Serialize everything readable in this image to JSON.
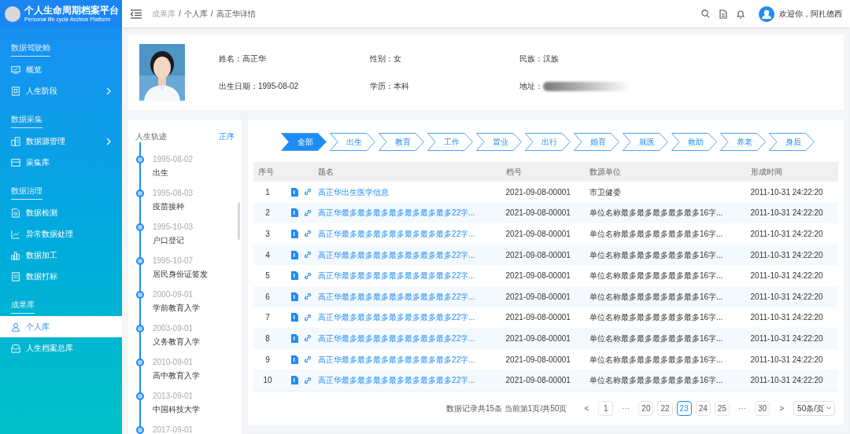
{
  "app": {
    "title": "个人生命周期档案平台",
    "subtitle": "Personal life cycle Archive Platform"
  },
  "sidebar": {
    "sections": [
      {
        "title": "数据驾驶舱",
        "items": [
          {
            "label": "概览",
            "selected": false,
            "expandable": false
          },
          {
            "label": "人生阶段",
            "selected": false,
            "expandable": true
          }
        ]
      },
      {
        "title": "数据采集",
        "items": [
          {
            "label": "数据源管理",
            "selected": false,
            "expandable": true
          },
          {
            "label": "采集库",
            "selected": false,
            "expandable": false
          }
        ]
      },
      {
        "title": "数据治理",
        "items": [
          {
            "label": "数据检测",
            "selected": false,
            "expandable": false
          },
          {
            "label": "异常数据处理",
            "selected": false,
            "expandable": false
          },
          {
            "label": "数据加工",
            "selected": false,
            "expandable": false
          },
          {
            "label": "数据打标",
            "selected": false,
            "expandable": false
          }
        ]
      },
      {
        "title": "成果库",
        "items": [
          {
            "label": "个人库",
            "selected": true,
            "expandable": false
          },
          {
            "label": "人生档案总库",
            "selected": false,
            "expandable": false
          }
        ]
      }
    ]
  },
  "breadcrumb": {
    "separator": "/",
    "items": [
      "成果库",
      "个人库",
      "高正华详情"
    ]
  },
  "user": {
    "greeting": "欢迎你，阿扎德西"
  },
  "profile": {
    "fields": [
      {
        "label": "姓名：",
        "value": "高正华"
      },
      {
        "label": "性别：",
        "value": "女"
      },
      {
        "label": "民族：",
        "value": "汉族"
      },
      {
        "label": "出生日期：",
        "value": "1995-08-02"
      },
      {
        "label": "学历：",
        "value": "本科"
      },
      {
        "label": "地址：",
        "redacted": true
      }
    ]
  },
  "timeline": {
    "title": "人生轨迹",
    "order": "正序",
    "events": [
      {
        "date": "1995-08-02",
        "title": "出生"
      },
      {
        "date": "1995-08-03",
        "title": "疫苗接种"
      },
      {
        "date": "1995-10-03",
        "title": "户口登记"
      },
      {
        "date": "1995-10-07",
        "title": "居民身份证签发"
      },
      {
        "date": "2000-09-01",
        "title": "学前教育入学"
      },
      {
        "date": "2003-09-01",
        "title": "义务教育入学"
      },
      {
        "date": "2010-09-01",
        "title": "高中教育入学"
      },
      {
        "date": "2013-09-01",
        "title": "中国科技大学"
      },
      {
        "date": "2017-09-01"
      }
    ]
  },
  "stages": [
    {
      "label": "全部",
      "selected": true
    },
    {
      "label": "出生",
      "selected": false
    },
    {
      "label": "教育",
      "selected": false
    },
    {
      "label": "工作",
      "selected": false
    },
    {
      "label": "置业",
      "selected": false
    },
    {
      "label": "出行",
      "selected": false
    },
    {
      "label": "婚育",
      "selected": false
    },
    {
      "label": "就医",
      "selected": false
    },
    {
      "label": "救助",
      "selected": false
    },
    {
      "label": "养老",
      "selected": false
    },
    {
      "label": "身后",
      "selected": false
    }
  ],
  "table": {
    "columns": [
      "序号",
      "题名",
      "档号",
      "数源单位",
      "形成时间"
    ],
    "rows": [
      {
        "no": "1",
        "title": "高正华出生医学信息",
        "archive_no": "2021-09-08-00001",
        "unit": "市卫健委",
        "time": "2011-10-31 24:22:20"
      },
      {
        "no": "2",
        "title": "高正华最多最多最多最多最多最多最多22字...",
        "archive_no": "2021-09-08-00001",
        "unit": "单位名称最多最多最多最多最多16字...",
        "time": "2011-10-31 24:22:20"
      },
      {
        "no": "3",
        "title": "高正华最多最多最多最多最多最多最多22字...",
        "archive_no": "2021-09-08-00001",
        "unit": "单位名称最多最多最多最多最多16字...",
        "time": "2011-10-31 24:22:20"
      },
      {
        "no": "4",
        "title": "高正华最多最多最多最多最多最多最多22字...",
        "archive_no": "2021-09-08-00001",
        "unit": "单位名称最多最多最多最多最多16字...",
        "time": "2011-10-31 24:22:20"
      },
      {
        "no": "5",
        "title": "高正华最多最多最多最多最多最多最多22字...",
        "archive_no": "2021-09-08-00001",
        "unit": "单位名称最多最多最多最多最多16字...",
        "time": "2011-10-31 24:22:20"
      },
      {
        "no": "6",
        "title": "高正华最多最多最多最多最多最多最多22字...",
        "archive_no": "2021-09-08-00001",
        "unit": "单位名称最多最多最多最多最多16字...",
        "time": "2011-10-31 24:22:20"
      },
      {
        "no": "7",
        "title": "高正华最多最多最多最多最多最多最多22字...",
        "archive_no": "2021-09-08-00001",
        "unit": "单位名称最多最多最多最多最多16字...",
        "time": "2011-10-31 24:22:20"
      },
      {
        "no": "8",
        "title": "高正华最多最多最多最多最多最多最多22字...",
        "archive_no": "2021-09-08-00001",
        "unit": "单位名称最多最多最多最多最多16字...",
        "time": "2011-10-31 24:22:20"
      },
      {
        "no": "9",
        "title": "高正华最多最多最多最多最多最多最多22字...",
        "archive_no": "2021-09-08-00001",
        "unit": "单位名称最多最多最多最多最多16字...",
        "time": "2011-10-31 24:22:20"
      },
      {
        "no": "10",
        "title": "高正华最多最多最多最多最多最多最多22字...",
        "archive_no": "2021-09-08-00001",
        "unit": "单位名称最多最多最多最多最多16字...",
        "time": "2011-10-31 24:22:20"
      }
    ]
  },
  "pagination": {
    "summary": "数据记录共15条 当前第1页/共50页",
    "prev": "<",
    "next": ">",
    "pages": [
      {
        "kind": "page",
        "label": "1",
        "selected": false
      },
      {
        "kind": "ellipsis",
        "label": "···"
      },
      {
        "kind": "page",
        "label": "20",
        "selected": false
      },
      {
        "kind": "page",
        "label": "22",
        "selected": false
      },
      {
        "kind": "page",
        "label": "23",
        "selected": true
      },
      {
        "kind": "page",
        "label": "24",
        "selected": false
      },
      {
        "kind": "page",
        "label": "25",
        "selected": false
      },
      {
        "kind": "ellipsis",
        "label": "···"
      },
      {
        "kind": "page",
        "label": "30",
        "selected": false
      }
    ],
    "page_size": "50条/页"
  }
}
